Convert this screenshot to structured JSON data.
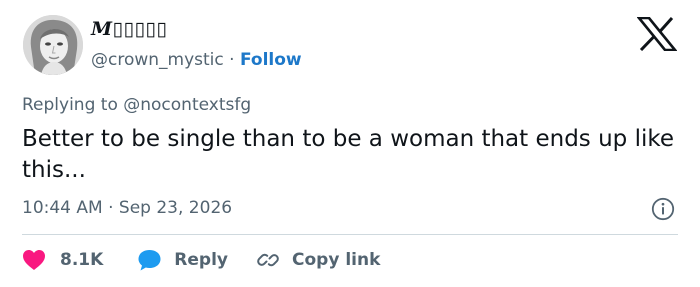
{
  "author": {
    "display_name": "M▯▯▯▯▯",
    "handle": "@crown_mystic",
    "separator": "·",
    "follow_label": "Follow"
  },
  "reply_context": {
    "prefix": "Replying to",
    "handle": "@nocontextsfg"
  },
  "tweet": {
    "text": "Better to be single than to be a woman that ends up like this...",
    "time": "10:44 AM",
    "separator": "·",
    "date": "Sep 23, 2026"
  },
  "actions": {
    "like_count": "8.1K",
    "reply_label": "Reply",
    "copy_link_label": "Copy link"
  },
  "colors": {
    "follow": "#1d78c9",
    "like": "#f91880",
    "reply_bubble": "#1d9bf0",
    "muted": "#536471"
  },
  "icons": [
    "x-logo-icon",
    "info-icon",
    "heart-icon",
    "speech-bubble-icon",
    "link-icon"
  ]
}
